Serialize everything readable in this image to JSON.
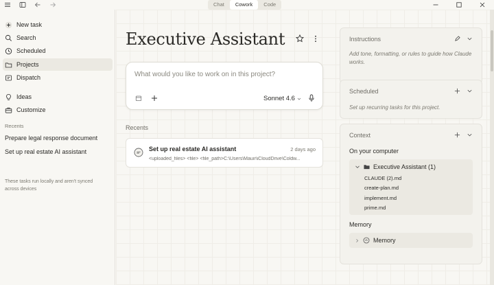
{
  "window": {
    "tabs": [
      {
        "label": "Chat",
        "active": false
      },
      {
        "label": "Cowork",
        "active": true
      },
      {
        "label": "Code",
        "active": false
      }
    ]
  },
  "sidebar": {
    "items": [
      {
        "label": "New task",
        "icon": "plus-icon"
      },
      {
        "label": "Search",
        "icon": "search-icon"
      },
      {
        "label": "Scheduled",
        "icon": "clock-icon"
      },
      {
        "label": "Projects",
        "icon": "folder-icon",
        "active": true
      },
      {
        "label": "Dispatch",
        "icon": "dispatch-icon"
      },
      {
        "label": "Ideas",
        "icon": "lightbulb-icon"
      },
      {
        "label": "Customize",
        "icon": "briefcase-icon"
      }
    ],
    "recents_label": "Recents",
    "recents": [
      "Prepare legal response document",
      "Set up real estate AI assistant"
    ],
    "note": "These tasks run locally and aren't synced across devices"
  },
  "main": {
    "title": "Executive Assistant",
    "composer": {
      "placeholder": "What would you like to work on in this project?",
      "model": "Sonnet 4.6"
    },
    "recents_label": "Recents",
    "recent_cards": [
      {
        "title": "Set up real estate AI assistant",
        "time": "2 days ago",
        "desc": "<uploaded_files> <file> <file_path>C:\\Users\\Mauir\\iCloudDrive\\Coldw..."
      }
    ]
  },
  "panels": {
    "instructions": {
      "title": "Instructions",
      "desc": "Add tone, formatting, or rules to guide how Claude works."
    },
    "scheduled": {
      "title": "Scheduled",
      "desc": "Set up recurring tasks for this project."
    },
    "context": {
      "title": "Context",
      "on_computer_label": "On your computer",
      "folder": "Executive Assistant (1)",
      "files": [
        "CLAUDE (2).md",
        "create-plan.md",
        "implement.md",
        "prime.md"
      ],
      "memory_label": "Memory",
      "memory_item": "Memory"
    }
  },
  "colors": {
    "background": "#f8f7f3",
    "card": "#ffffff",
    "panel": "#f3f2ed",
    "active": "#ebe9e2",
    "text": "#2b2a27",
    "muted": "#7b7970"
  }
}
